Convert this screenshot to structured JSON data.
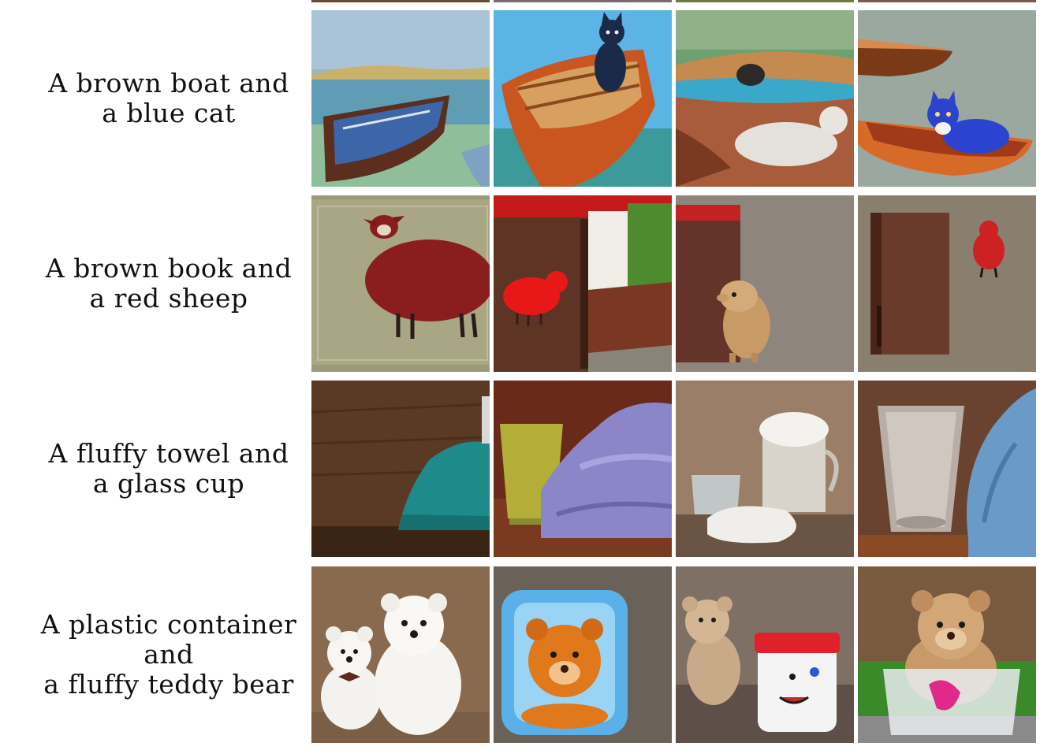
{
  "rows": [
    {
      "line1": "A brown boat and",
      "line2": "a blue cat"
    },
    {
      "line1": "A brown book and",
      "line2": "a red sheep"
    },
    {
      "line1": "A fluffy towel and",
      "line2": "a glass cup"
    },
    {
      "line1": "A plastic container and",
      "line2": "a fluffy teddy bear"
    }
  ]
}
